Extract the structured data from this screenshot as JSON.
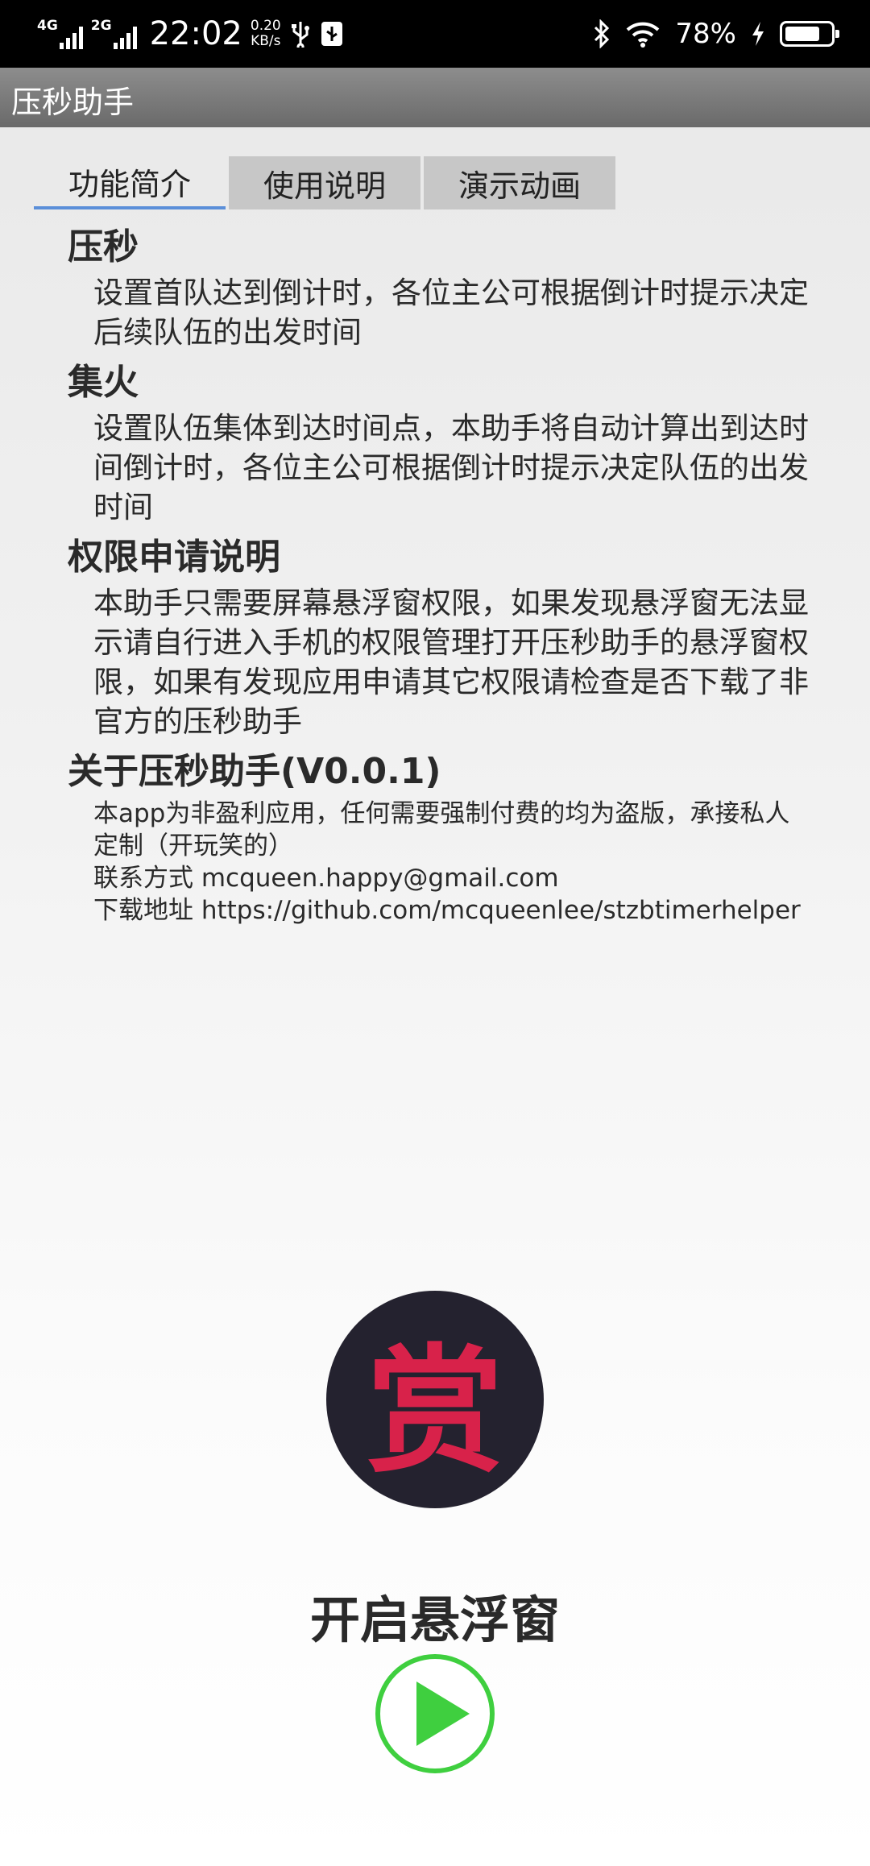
{
  "status_bar": {
    "net1": "4G",
    "net2": "2G",
    "time": "22:02",
    "speed_value": "0.20",
    "speed_unit": "KB/s",
    "battery": "78%",
    "battery_level": 0.78,
    "icons": [
      "usb-icon",
      "usb-debug-icon",
      "bluetooth-icon",
      "wifi-icon",
      "charging-icon",
      "battery-icon"
    ]
  },
  "app_bar": {
    "title": "压秒助手"
  },
  "tabs": [
    {
      "label": "功能简介",
      "active": true
    },
    {
      "label": "使用说明",
      "active": false
    },
    {
      "label": "演示动画",
      "active": false
    }
  ],
  "sections": {
    "press": {
      "title": "压秒",
      "body": "设置首队达到倒计时，各位主公可根据倒计时提示决定后续队伍的出发时间"
    },
    "gather": {
      "title": "集火",
      "body": "设置队伍集体到达时间点，本助手将自动计算出到达时间倒计时，各位主公可根据倒计时提示决定队伍的出发时间"
    },
    "permission": {
      "title": "权限申请说明",
      "body": "本助手只需要屏幕悬浮窗权限，如果发现悬浮窗无法显示请自行进入手机的权限管理打开压秒助手的悬浮窗权限，如果有发现应用申请其它权限请检查是否下载了非官方的压秒助手"
    },
    "about": {
      "title": "关于压秒助手(V0.0.1)",
      "line1": "本app为非盈利应用，任何需要强制付费的均为盗版，承接私人定制（开玩笑的）",
      "line2": "联系方式 mcqueen.happy@gmail.com",
      "line3": "下载地址 https://github.com/mcqueenlee/stzbtimerhelper"
    }
  },
  "reward": {
    "label": "赏",
    "bg_color": "#24222f",
    "text_color": "#d8224a"
  },
  "float_window": {
    "label": "开启悬浮窗"
  },
  "play": {
    "icon": "play-icon",
    "color": "#3fcf3f"
  }
}
